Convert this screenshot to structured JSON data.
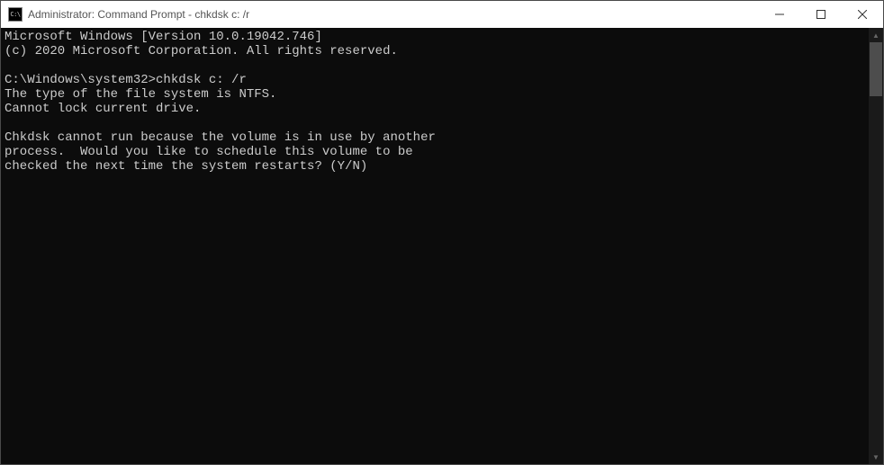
{
  "window": {
    "title": "Administrator: Command Prompt - chkdsk  c: /r",
    "icon_text": "C:\\"
  },
  "terminal": {
    "line1": "Microsoft Windows [Version 10.0.19042.746]",
    "line2": "(c) 2020 Microsoft Corporation. All rights reserved.",
    "blank1": "",
    "prompt": "C:\\Windows\\system32>",
    "command": "chkdsk c: /r",
    "out1": "The type of the file system is NTFS.",
    "out2": "Cannot lock current drive.",
    "blank2": "",
    "out3": "Chkdsk cannot run because the volume is in use by another",
    "out4": "process.  Would you like to schedule this volume to be",
    "out5": "checked the next time the system restarts? (Y/N)"
  }
}
